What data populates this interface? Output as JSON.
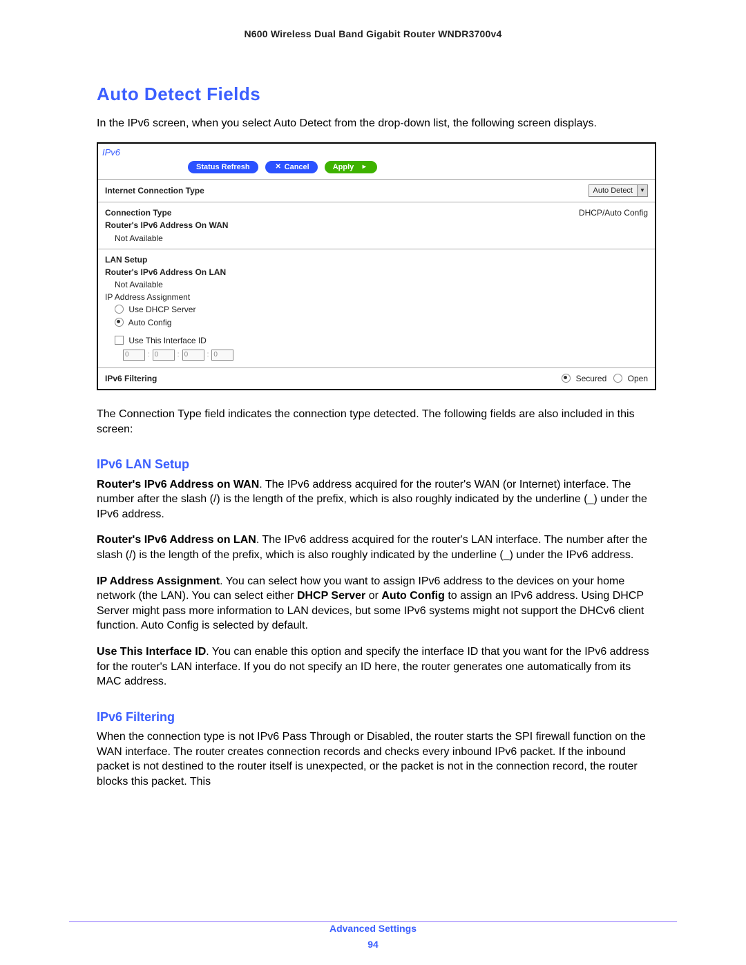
{
  "header": {
    "product": "N600 Wireless Dual Band Gigabit Router WNDR3700v4"
  },
  "section": {
    "title": "Auto Detect Fields",
    "intro": "In the IPv6 screen, when you select Auto Detect from the drop-down list, the following screen displays.",
    "after_panel": "The Connection Type field indicates the connection type detected. The following fields are also included in this screen:"
  },
  "panel": {
    "title": "IPv6",
    "buttons": {
      "refresh": "Status Refresh",
      "cancel": "Cancel",
      "apply": "Apply"
    },
    "ict_label": "Internet Connection Type",
    "ict_value": "Auto Detect",
    "conn_type_label": "Connection Type",
    "conn_type_value": "DHCP/Auto Config",
    "wan_label": "Router's IPv6 Address On WAN",
    "not_available": "Not Available",
    "lan_setup_heading": "LAN Setup",
    "lan_label": "Router's IPv6 Address On LAN",
    "ip_assign_label": "IP Address Assignment",
    "opt_dhcp": "Use DHCP Server",
    "opt_auto": "Auto Config",
    "use_ifid_label": "Use This Interface ID",
    "ifid": [
      "0",
      "0",
      "0",
      "0"
    ],
    "filtering_label": "IPv6 Filtering",
    "filtering_secured": "Secured",
    "filtering_open": "Open"
  },
  "lan": {
    "heading": "IPv6 LAN Setup",
    "p1_bold": "Router's IPv6 Address on WAN",
    "p1_rest": ". The IPv6 address acquired for the router's WAN (or Internet) interface. The number after the slash (/) is the length of the prefix, which is also roughly indicated by the underline (_) under the IPv6 address.",
    "p2_bold": "Router's IPv6 Address on LAN",
    "p2_rest": ". The IPv6 address acquired for the router's LAN interface. The number after the slash (/) is the length of the prefix, which is also roughly indicated by the underline (_) under the IPv6 address.",
    "p3_bold": "IP Address Assignment",
    "p3_mid1": ". You can select how you want to assign IPv6 address to the devices on your home network (the LAN). You can select either ",
    "p3_bold2": "DHCP Server",
    "p3_mid2": " or ",
    "p3_bold3": "Auto Config",
    "p3_rest": " to assign an IPv6 address. Using DHCP Server might pass more information to LAN devices, but some IPv6 systems might not support the DHCv6 client function. Auto Config is selected by default.",
    "p4_bold": "Use This Interface ID",
    "p4_rest": ". You can enable this option and specify the interface ID that you want for the IPv6 address for the router's LAN interface. If you do not specify an ID here, the router generates one automatically from its MAC address."
  },
  "filter": {
    "heading": "IPv6 Filtering",
    "p1": "When the connection type is not IPv6 Pass Through or Disabled, the router starts the SPI firewall function on the WAN interface. The router creates connection records and checks every inbound IPv6 packet. If the inbound packet is not destined to the router itself is unexpected, or the packet is not in the connection record, the router blocks this packet. This"
  },
  "footer": {
    "section": "Advanced Settings",
    "page": "94"
  }
}
